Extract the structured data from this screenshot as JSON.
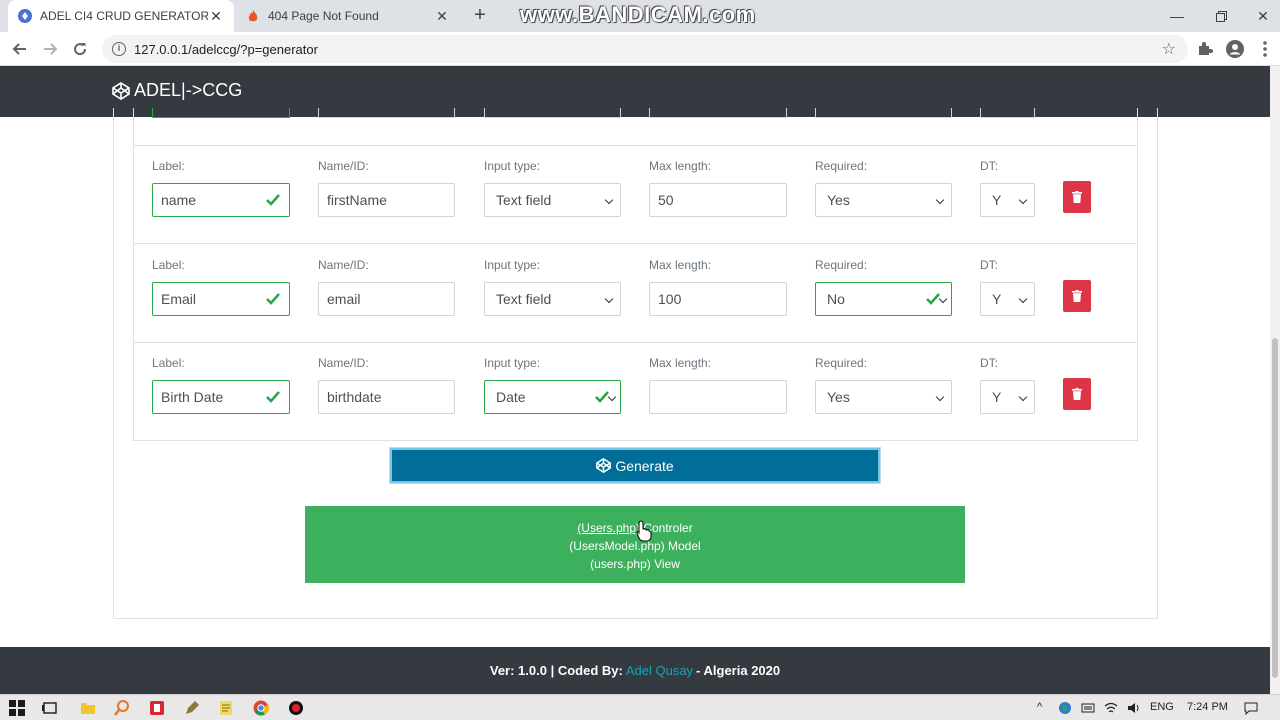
{
  "browser": {
    "tabs": [
      {
        "title": "ADEL CI4 CRUD GENERATOR",
        "active": true
      },
      {
        "title": "404 Page Not Found",
        "active": false
      }
    ],
    "watermark": "www.BANDICAM.com",
    "url": "127.0.0.1/adelccg/?p=generator"
  },
  "app": {
    "brand": "ADEL|->CCG"
  },
  "labels": {
    "label": "Label:",
    "name_id": "Name/ID:",
    "input_type": "Input type:",
    "max_length": "Max length:",
    "required": "Required:",
    "dt": "DT:"
  },
  "rows": [
    {
      "label": "name",
      "name_id": "firstName",
      "input_type": "Text field",
      "max_length": "50",
      "required": "Yes",
      "dt": "Y"
    },
    {
      "label": "Email",
      "name_id": "email",
      "input_type": "Text field",
      "max_length": "100",
      "required": "No",
      "dt": "Y"
    },
    {
      "label": "Birth Date",
      "name_id": "birthdate",
      "input_type": "Date",
      "max_length": "",
      "required": "Yes",
      "dt": "Y"
    }
  ],
  "generate_label": "Generate",
  "result": {
    "line1_link": "(Users.php)",
    "line1_text": " Controler",
    "line2": "(UsersModel.php) Model",
    "line3": "(users.php) View"
  },
  "footer": {
    "prefix": "Ver: 1.0.0 | Coded By:",
    "author": "Adel Qusay",
    "suffix": "- Algeria 2020"
  },
  "taskbar": {
    "language": "ENG",
    "time": "7:24 PM"
  },
  "colors": {
    "navbar": "#343a40",
    "valid": "#28a745",
    "danger": "#dc3545",
    "primary": "#006e99",
    "success": "#3cb05c"
  }
}
